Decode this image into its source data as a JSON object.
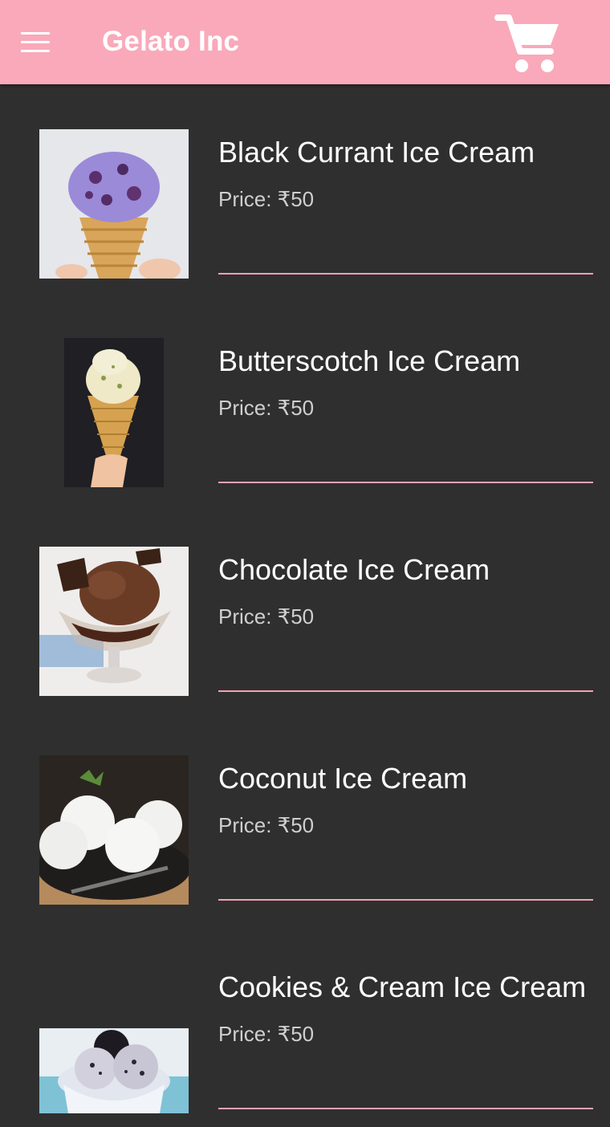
{
  "appbar": {
    "title": "Gelato Inc",
    "background": "#f9a9ba",
    "menu_icon": "hamburger-menu-icon",
    "cart_icon": "shopping-cart-icon"
  },
  "products": [
    {
      "name": "Black Currant Ice Cream",
      "price": "Price: ₹50",
      "image": "black-currant-cone-image"
    },
    {
      "name": "Butterscotch Ice Cream",
      "price": "Price: ₹50",
      "image": "butterscotch-cone-image"
    },
    {
      "name": "Chocolate Ice Cream",
      "price": "Price: ₹50",
      "image": "chocolate-sundae-image"
    },
    {
      "name": "Coconut Ice Cream",
      "price": "Price: ₹50",
      "image": "coconut-scoops-image"
    },
    {
      "name": "Cookies & Cream Ice Cream",
      "price": "Price: ₹50",
      "image": "cookies-cream-bowl-image"
    }
  ],
  "colors": {
    "background": "#2f2f2f",
    "accent": "#f9a9ba",
    "divider": "#f2a1b3",
    "title_text": "#ffffff",
    "price_text": "#cfcfcf"
  }
}
